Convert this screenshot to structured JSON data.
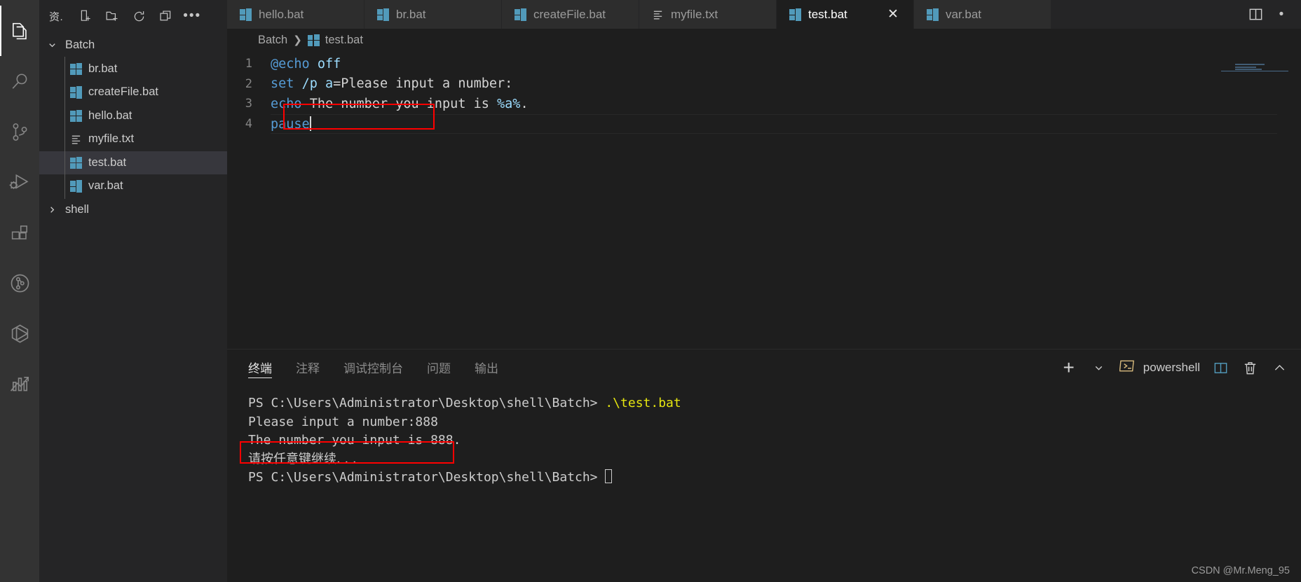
{
  "activity_bar": {
    "items": [
      {
        "name": "explorer",
        "icon": "files-icon",
        "active": true
      },
      {
        "name": "search",
        "icon": "search-icon",
        "active": false
      },
      {
        "name": "source-control",
        "icon": "source-control-icon",
        "active": false
      },
      {
        "name": "run-and-debug",
        "icon": "run-debug-icon",
        "active": false
      },
      {
        "name": "extensions",
        "icon": "extensions-icon",
        "active": false
      },
      {
        "name": "gitlens",
        "icon": "gitlens-circle-icon",
        "active": false
      },
      {
        "name": "remote-containers",
        "icon": "cube-icon",
        "active": false
      },
      {
        "name": "analytics",
        "icon": "chart-arrow-icon",
        "active": false
      }
    ]
  },
  "sidebar": {
    "title": "资.",
    "actions": [
      {
        "name": "new-file",
        "icon": "new-file-icon"
      },
      {
        "name": "new-folder",
        "icon": "new-folder-icon"
      },
      {
        "name": "refresh-explorer",
        "icon": "refresh-icon"
      },
      {
        "name": "collapse-folders",
        "icon": "collapse-all-icon"
      },
      {
        "name": "explorer-more-actions",
        "icon": "ellipsis-icon"
      }
    ],
    "tree": [
      {
        "label": "Batch",
        "type": "folder",
        "expanded": true,
        "selected": false,
        "icon": "chevron-down-icon"
      },
      {
        "label": "br.bat",
        "type": "file",
        "icon": "windows-bat-icon",
        "selected": false
      },
      {
        "label": "createFile.bat",
        "type": "file",
        "icon": "windows-bat-icon",
        "selected": false
      },
      {
        "label": "hello.bat",
        "type": "file",
        "icon": "windows-bat-icon",
        "selected": false
      },
      {
        "label": "myfile.txt",
        "type": "file",
        "icon": "text-file-icon",
        "selected": false
      },
      {
        "label": "test.bat",
        "type": "file",
        "icon": "windows-bat-icon",
        "selected": true
      },
      {
        "label": "var.bat",
        "type": "file",
        "icon": "windows-bat-icon",
        "selected": false
      },
      {
        "label": "shell",
        "type": "folder",
        "expanded": false,
        "selected": false,
        "icon": "chevron-right-icon"
      }
    ]
  },
  "editor": {
    "tabs": [
      {
        "label": "hello.bat",
        "icon": "windows-bat-icon",
        "active": false,
        "closable": false
      },
      {
        "label": "br.bat",
        "icon": "windows-bat-icon",
        "active": false,
        "closable": false
      },
      {
        "label": "createFile.bat",
        "icon": "windows-bat-icon",
        "active": false,
        "closable": false
      },
      {
        "label": "myfile.txt",
        "icon": "text-file-icon",
        "active": false,
        "closable": false
      },
      {
        "label": "test.bat",
        "icon": "windows-bat-icon",
        "active": true,
        "closable": true,
        "close_glyph": "✕"
      },
      {
        "label": "var.bat",
        "icon": "windows-bat-icon",
        "active": false,
        "closable": false
      }
    ],
    "tab_actions": [
      {
        "name": "split-editor",
        "icon": "split-editor-icon"
      },
      {
        "name": "editor-more-actions",
        "icon": "ellipsis-icon"
      }
    ],
    "breadcrumb": {
      "root": "Batch",
      "separator": "❯",
      "file": "test.bat",
      "file_icon": "windows-bat-icon"
    },
    "lines": [
      {
        "number": "1",
        "tokens": [
          {
            "t": "@echo",
            "c": "kw"
          },
          {
            "t": " ",
            "c": "op"
          },
          {
            "t": "off",
            "c": "var"
          }
        ]
      },
      {
        "number": "2",
        "tokens": [
          {
            "t": "set",
            "c": "kw"
          },
          {
            "t": " ",
            "c": "op"
          },
          {
            "t": "/p",
            "c": "var"
          },
          {
            "t": " ",
            "c": "op"
          },
          {
            "t": "a",
            "c": "var"
          },
          {
            "t": "=Please input a number:",
            "c": "op"
          }
        ]
      },
      {
        "number": "3",
        "tokens": [
          {
            "t": "echo",
            "c": "kw"
          },
          {
            "t": " The number you input is ",
            "c": "op"
          },
          {
            "t": "%a%",
            "c": "var"
          },
          {
            "t": ".",
            "c": "op"
          }
        ]
      },
      {
        "number": "4",
        "tokens": [
          {
            "t": "pause",
            "c": "kw"
          }
        ]
      }
    ],
    "cursor_line": "4",
    "highlight_label": "pause-highlight-box"
  },
  "panel": {
    "tabs": [
      {
        "label": "终端",
        "active": true
      },
      {
        "label": "注释",
        "active": false
      },
      {
        "label": "调试控制台",
        "active": false
      },
      {
        "label": "问题",
        "active": false
      },
      {
        "label": "输出",
        "active": false
      }
    ],
    "actions": {
      "new_terminal_glyph": "+",
      "new_terminal_dropdown": "chevron-down-icon",
      "shell_name": "powershell",
      "shell_icon": "terminal-icon",
      "split_terminal": "split-terminal-icon",
      "kill_terminal": "trash-icon",
      "collapse_panel": "chevron-up-icon"
    },
    "terminal_lines": [
      {
        "segments": [
          {
            "t": "PS C:\\Users\\Administrator\\Desktop\\shell\\Batch> ",
            "c": "plain"
          },
          {
            "t": ".\\test.bat",
            "c": "yellow"
          }
        ]
      },
      {
        "segments": [
          {
            "t": "Please input a number:888",
            "c": "plain"
          }
        ]
      },
      {
        "segments": [
          {
            "t": "The number you input is 888.",
            "c": "plain"
          }
        ]
      },
      {
        "segments": [
          {
            "t": "请按任意键继续. . .",
            "c": "cjk"
          }
        ],
        "highlighted": true
      },
      {
        "segments": [
          {
            "t": "PS C:\\Users\\Administrator\\Desktop\\shell\\Batch> ",
            "c": "plain"
          }
        ],
        "caret": true
      }
    ]
  },
  "watermark": "CSDN @Mr.Meng_95",
  "colors": {
    "accent_blue": "#519aba",
    "annotation_red": "#ff0000",
    "terminal_yellow": "#e5e510",
    "keyword_blue": "#569cd6",
    "variable_blue": "#9cdcfe"
  }
}
